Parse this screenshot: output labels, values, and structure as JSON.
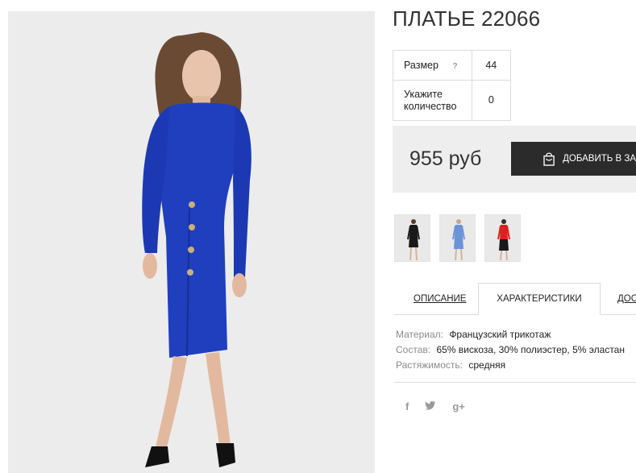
{
  "product": {
    "title": "ПЛАТЬЕ 22066",
    "photo_alt": "blue-dress-photo"
  },
  "options": {
    "size_label": "Размер",
    "size_help": "?",
    "size_value": "44",
    "qty_label_line1": "Укажите",
    "qty_label_line2": "количество",
    "qty_value": "0"
  },
  "purchase": {
    "price": "955 руб",
    "add_button": "ДОБАВИТЬ В ЗА"
  },
  "colors": {
    "dress_main": "#1f3fbf",
    "thumbs": [
      "#1a1a1a",
      "#4a78d0",
      "#e02020"
    ]
  },
  "tabs": {
    "description": "ОПИСАНИЕ",
    "characteristics": "ХАРАКТЕРИСТИКИ",
    "delivery": "ДОС"
  },
  "specs": [
    {
      "key": "Материал:",
      "value": "Французский трикотаж"
    },
    {
      "key": "Состав:",
      "value": "65% вискоза, 30% полиэстер, 5% эластан"
    },
    {
      "key": "Растяжимость:",
      "value": "средняя"
    }
  ],
  "social": {
    "facebook": "f",
    "twitter": "t",
    "googleplus": "g+"
  }
}
